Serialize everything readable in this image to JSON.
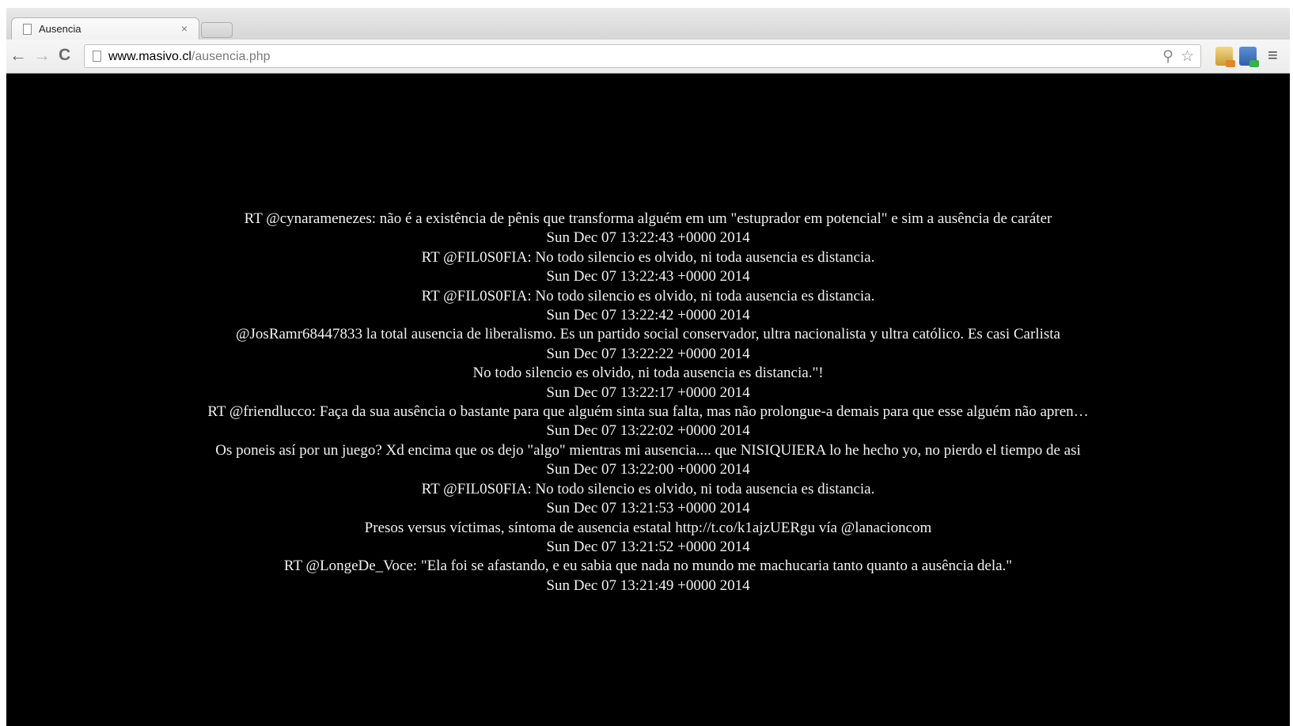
{
  "tab": {
    "title": "Ausencia",
    "close": "×"
  },
  "address": {
    "host": "www.masivo.cl",
    "path": "/ausencia.php"
  },
  "icons": {
    "back": "back-arrow-icon",
    "forward": "forward-arrow-icon",
    "reload": "reload-icon",
    "zoom": "zoom-icon",
    "bookmark": "star-icon",
    "menu": "hamburger-menu-icon"
  },
  "tweets": [
    {
      "text": "RT @cynaramenezes: não é a existência de pênis que transforma alguém em um \"estuprador em potencial\" e sim a ausência de caráter",
      "time": "Sun Dec 07 13:22:43 +0000 2014"
    },
    {
      "text": "RT @FIL0S0FIA: No todo silencio es olvido, ni toda ausencia es distancia.",
      "time": "Sun Dec 07 13:22:43 +0000 2014"
    },
    {
      "text": "RT @FIL0S0FIA: No todo silencio es olvido, ni toda ausencia es distancia.",
      "time": "Sun Dec 07 13:22:42 +0000 2014"
    },
    {
      "text": "@JosRamr68447833 la total ausencia de liberalismo. Es un partido social conservador, ultra nacionalista y ultra católico. Es casi Carlista",
      "time": "Sun Dec 07 13:22:22 +0000 2014"
    },
    {
      "text": "No todo silencio es olvido, ni toda ausencia es distancia.\"!",
      "time": "Sun Dec 07 13:22:17 +0000 2014"
    },
    {
      "text": "RT @friendlucco: Faça da sua ausência o bastante para que alguém sinta sua falta, mas não prolongue-a demais para que esse alguém não apren…",
      "time": "Sun Dec 07 13:22:02 +0000 2014"
    },
    {
      "text": "Os poneis así por un juego? Xd encima que os dejo \"algo\" mientras mi ausencia.... que NISIQUIERA lo he hecho yo, no pierdo el tiempo de asi",
      "time": "Sun Dec 07 13:22:00 +0000 2014"
    },
    {
      "text": "RT @FIL0S0FIA: No todo silencio es olvido, ni toda ausencia es distancia.",
      "time": "Sun Dec 07 13:21:53 +0000 2014"
    },
    {
      "text": "Presos versus víctimas, síntoma de ausencia estatal http://t.co/k1ajzUERgu vía @lanacioncom",
      "time": "Sun Dec 07 13:21:52 +0000 2014"
    },
    {
      "text": "RT @LongeDe_Voce: \"Ela foi se afastando, e eu sabia que nada no mundo me machucaria tanto quanto a ausência dela.\"",
      "time": "Sun Dec 07 13:21:49 +0000 2014"
    }
  ]
}
